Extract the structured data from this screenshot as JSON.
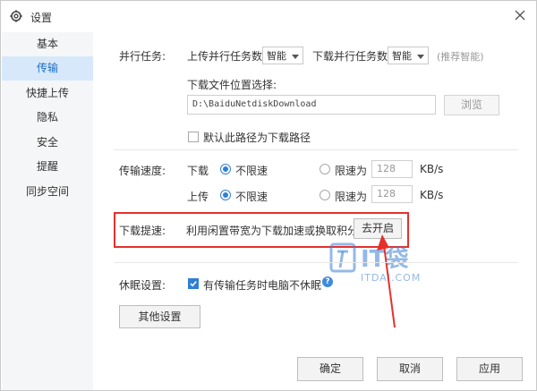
{
  "window": {
    "title": "设置",
    "close_icon": "close-icon",
    "settings_icon": "gear-icon"
  },
  "sidebar": {
    "items": [
      {
        "label": "基本"
      },
      {
        "label": "传输",
        "active": true
      },
      {
        "label": "快捷上传"
      },
      {
        "label": "隐私"
      },
      {
        "label": "安全"
      },
      {
        "label": "提醒"
      },
      {
        "label": "同步空间"
      }
    ]
  },
  "parallel": {
    "label": "并行任务:",
    "upload_label": "上传并行任务数",
    "upload_value": "智能",
    "download_label": "下载并行任务数",
    "download_value": "智能",
    "hint": "(推荐智能)"
  },
  "download_location": {
    "label": "下载文件位置选择:",
    "path": "D:\\BaiduNetdiskDownload",
    "browse_label": "浏览",
    "default_checkbox_label": "默认此路径为下载路径",
    "default_checked": false
  },
  "speed": {
    "label": "传输速度:",
    "download": {
      "label": "下载",
      "unlimited_label": "不限速",
      "limit_label": "限速为",
      "limit_value": "128",
      "unit": "KB/s",
      "selected": "unlimited"
    },
    "upload": {
      "label": "上传",
      "unlimited_label": "不限速",
      "limit_label": "限速为",
      "limit_value": "128",
      "unit": "KB/s",
      "selected": "unlimited"
    }
  },
  "accelerate": {
    "label": "下载提速:",
    "description": "利用闲置带宽为下载加速或换取积分",
    "button_label": "去开启"
  },
  "sleep": {
    "label": "休眠设置:",
    "checkbox_label": "有传输任务时电脑不休眠",
    "checked": true,
    "help_icon": "help-icon"
  },
  "other_settings_label": "其他设置",
  "footer": {
    "ok_label": "确定",
    "cancel_label": "取消",
    "apply_label": "应用"
  },
  "watermark": {
    "logo": "IT袋",
    "url": "ITDAI.COM",
    "color": "#3a7fd5"
  },
  "colors": {
    "accent": "#2f7fd6",
    "highlight": "#e5312b",
    "sidebar_active": "#d7e8fa"
  }
}
